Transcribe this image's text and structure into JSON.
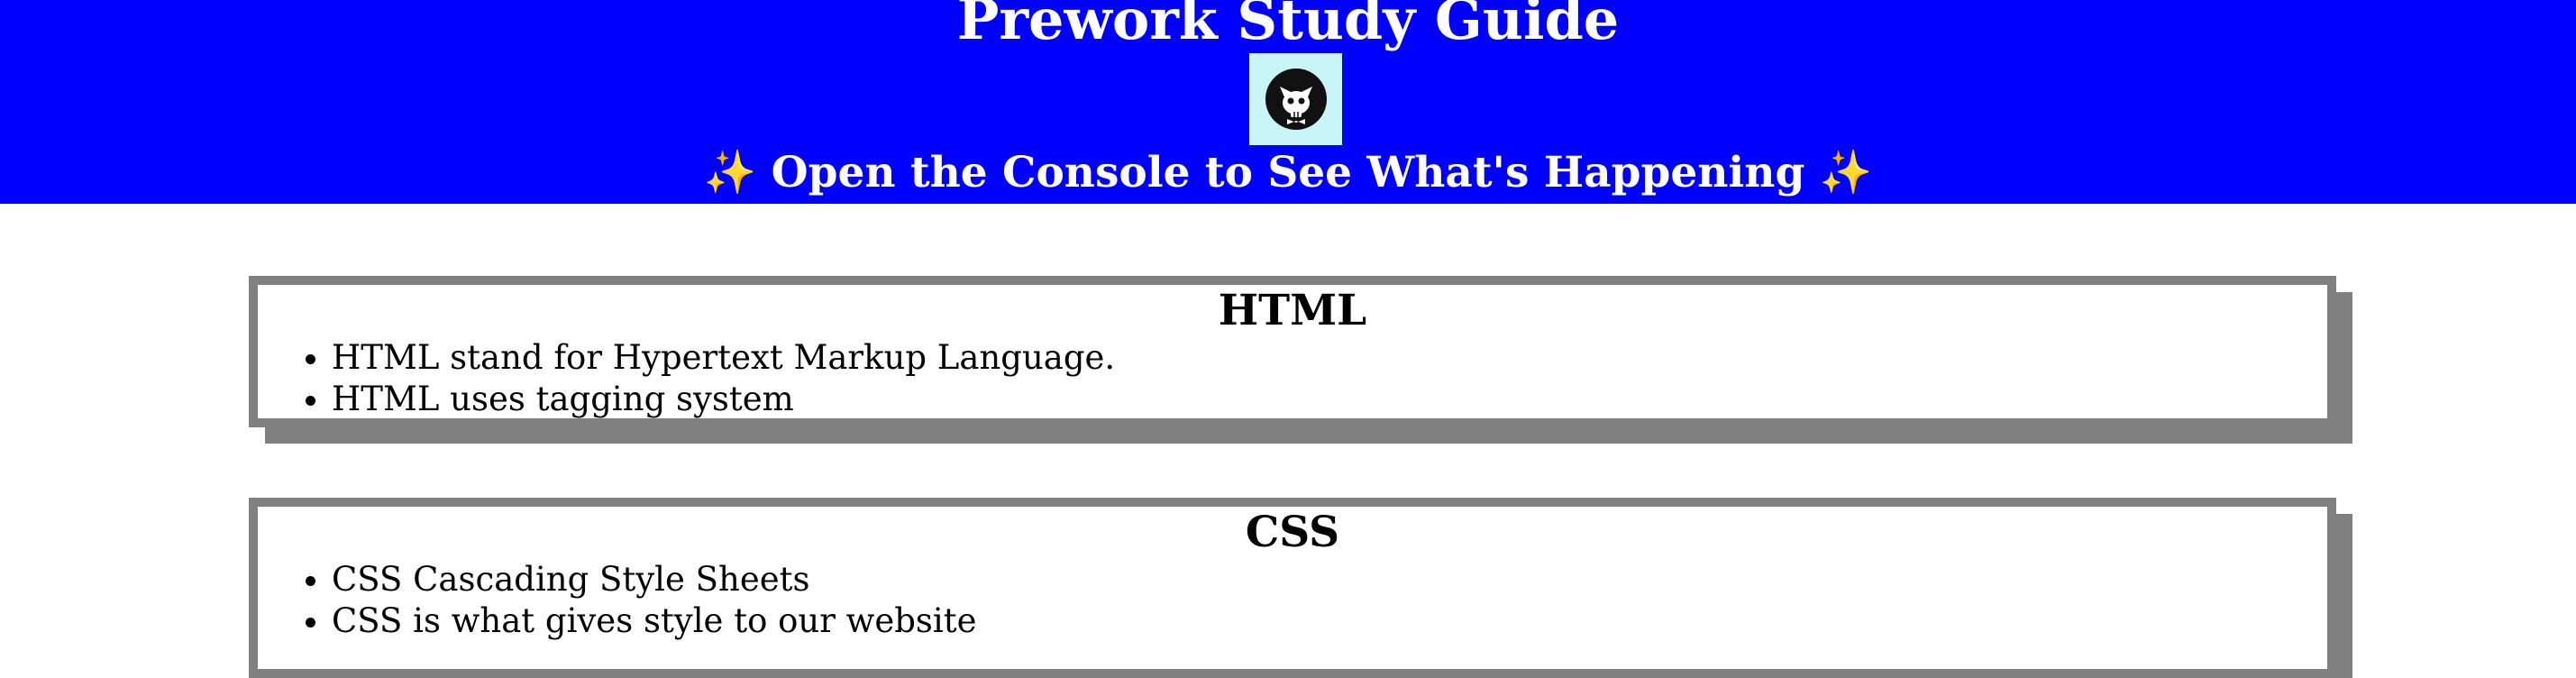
{
  "header": {
    "title": "Prework Study Guide",
    "logo_icon": "cat-skull-logo-icon",
    "subtitle_sparkle_left": "✨",
    "subtitle": "Open the Console to See What's Happening",
    "subtitle_sparkle_right": "✨",
    "background_color": "#0000ff",
    "text_color": "#ffffff",
    "logo_background": "#c9f5f7"
  },
  "sections": [
    {
      "title": "HTML",
      "items": [
        "HTML stand for Hypertext Markup Language.",
        "HTML uses tagging system"
      ]
    },
    {
      "title": "CSS",
      "items": [
        "CSS Cascading Style Sheets",
        "CSS is what gives style to our website"
      ]
    }
  ],
  "card_border_color": "#808080"
}
